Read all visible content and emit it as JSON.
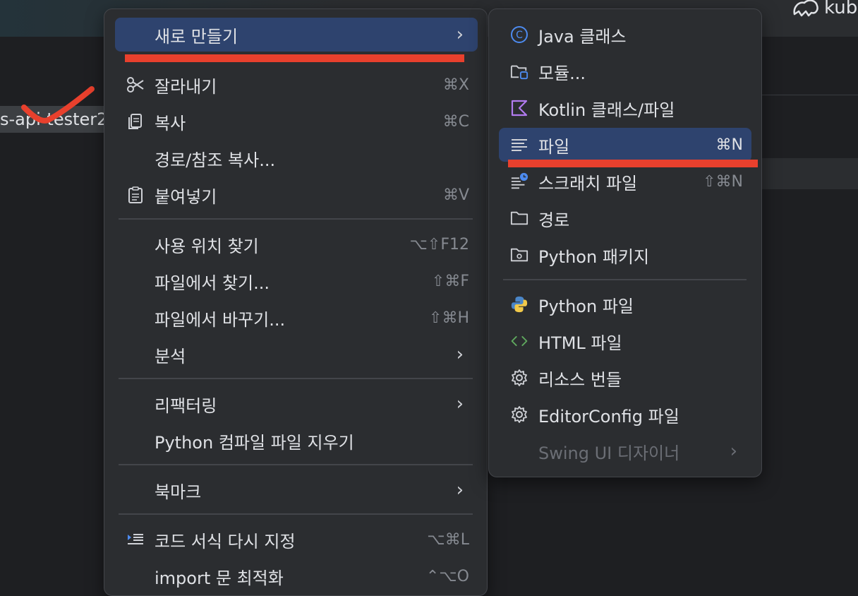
{
  "background": {
    "tree_item_label": "s-api-tester2",
    "top_right_label": "kub"
  },
  "menu_main": {
    "items": [
      {
        "label": "새로 만들기",
        "shortcut": "",
        "submenu": true,
        "icon": ""
      },
      {
        "label": "잘라내기",
        "shortcut": "⌘X",
        "icon": "scissors-icon"
      },
      {
        "label": "복사",
        "shortcut": "⌘C",
        "icon": "copy-icon"
      },
      {
        "label": "경로/참조 복사...",
        "shortcut": "",
        "icon": ""
      },
      {
        "label": "붙여넣기",
        "shortcut": "⌘V",
        "icon": "clipboard-icon"
      },
      {
        "label": "사용 위치 찾기",
        "shortcut": "⌥⇧F12",
        "icon": ""
      },
      {
        "label": "파일에서 찾기...",
        "shortcut": "⇧⌘F",
        "icon": ""
      },
      {
        "label": "파일에서 바꾸기...",
        "shortcut": "⇧⌘H",
        "icon": ""
      },
      {
        "label": "분석",
        "shortcut": "",
        "submenu": true,
        "icon": ""
      },
      {
        "label": "리팩터링",
        "shortcut": "",
        "submenu": true,
        "icon": ""
      },
      {
        "label": "Python 컴파일 파일 지우기",
        "shortcut": "",
        "icon": ""
      },
      {
        "label": "북마크",
        "shortcut": "",
        "submenu": true,
        "icon": ""
      },
      {
        "label": "코드 서식 다시 지정",
        "shortcut": "⌥⌘L",
        "icon": "format-icon"
      },
      {
        "label": "import 문 최적화",
        "shortcut": "⌃⌥O",
        "icon": ""
      }
    ],
    "arrow": "›"
  },
  "menu_sub": {
    "items": [
      {
        "label": "Java 클래스",
        "shortcut": "",
        "icon": "java-class-icon"
      },
      {
        "label": "모듈...",
        "shortcut": "",
        "icon": "module-folder-icon"
      },
      {
        "label": "Kotlin 클래스/파일",
        "shortcut": "",
        "icon": "kotlin-icon"
      },
      {
        "label": "파일",
        "shortcut": "⌘N",
        "icon": "text-file-icon"
      },
      {
        "label": "스크래치 파일",
        "shortcut": "⇧⌘N",
        "icon": "scratch-file-icon"
      },
      {
        "label": "경로",
        "shortcut": "",
        "icon": "folder-icon"
      },
      {
        "label": "Python 패키지",
        "shortcut": "",
        "icon": "package-folder-icon"
      },
      {
        "label": "Python 파일",
        "shortcut": "",
        "icon": "python-icon"
      },
      {
        "label": "HTML 파일",
        "shortcut": "",
        "icon": "html-icon"
      },
      {
        "label": "리소스 번들",
        "shortcut": "",
        "icon": "gear-icon"
      },
      {
        "label": "EditorConfig 파일",
        "shortcut": "",
        "icon": "gear-icon"
      },
      {
        "label": "Swing UI 디자이너",
        "shortcut": "",
        "icon": "",
        "disabled": true
      }
    ],
    "arrow": "›"
  },
  "colors": {
    "menu_bg": "#2b2d30",
    "highlight": "#2e436e",
    "annotation_red": "#e8402d",
    "shortcut_text": "#868a91"
  }
}
